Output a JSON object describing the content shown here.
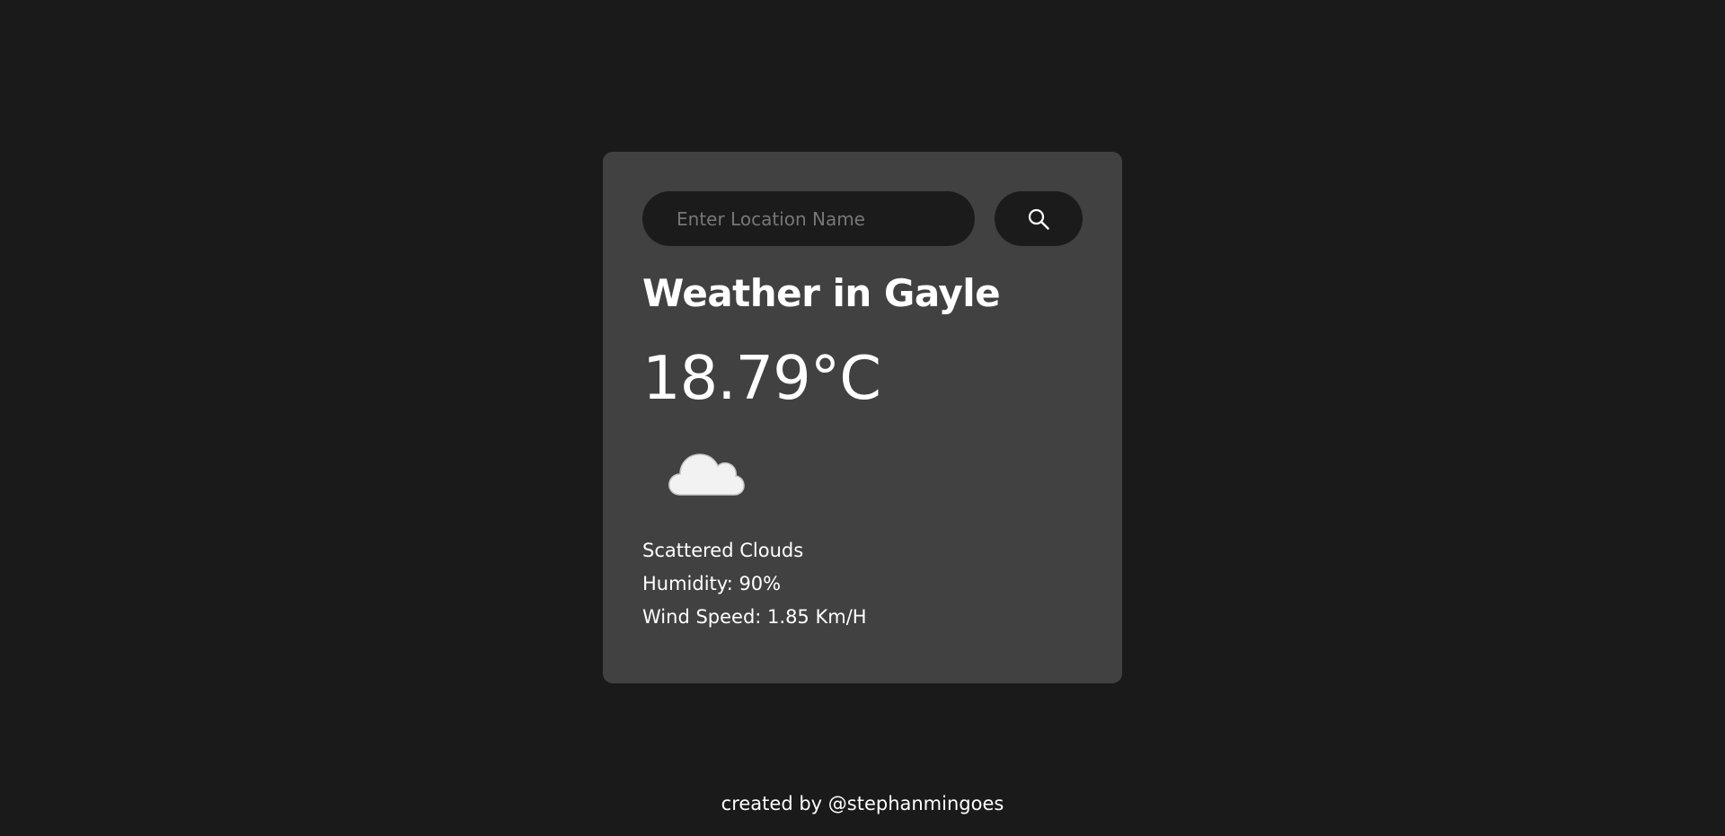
{
  "search": {
    "placeholder": "Enter Location Name",
    "value": "",
    "button_icon": "search-icon"
  },
  "weather": {
    "title": "Weather in Gayle",
    "temperature": "18.79°C",
    "condition_icon": "cloud-icon",
    "description": "Scattered Clouds",
    "humidity": "Humidity: 90%",
    "wind": "Wind Speed: 1.85 Km/H"
  },
  "footer": {
    "credit": "created by @stephanmingoes"
  },
  "colors": {
    "background": "#1a1a1a",
    "card": "#414141",
    "input": "#1b1b1b",
    "text": "#ffffff",
    "placeholder": "#777777"
  }
}
